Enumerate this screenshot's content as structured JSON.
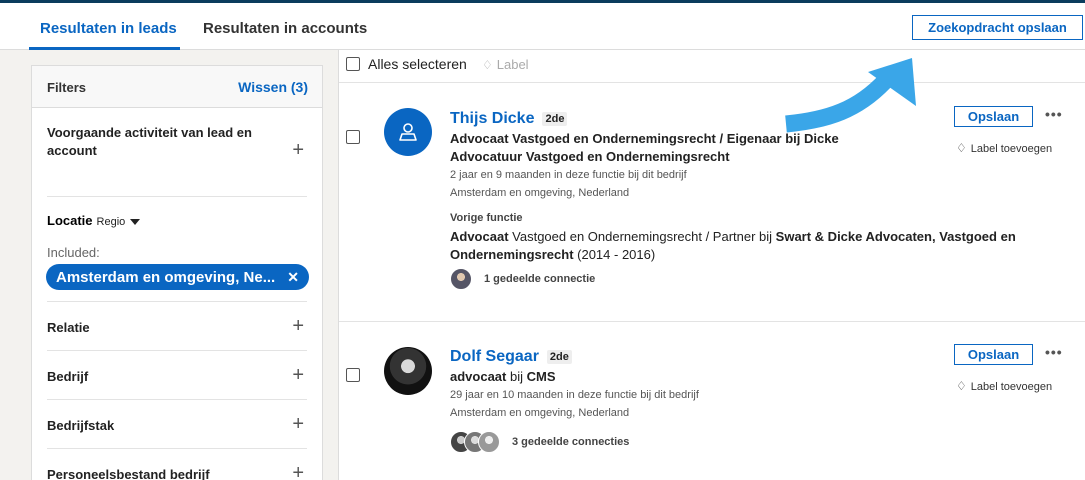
{
  "tabs": [
    {
      "label": "Resultaten in leads",
      "active": true
    },
    {
      "label": "Resultaten in accounts",
      "active": false
    }
  ],
  "save_search_label": "Zoekopdracht opslaan",
  "filters": {
    "title": "Filters",
    "clear_label": "Wissen (3)",
    "activity_label": "Voorgaande activiteit van lead en account",
    "location": {
      "label": "Locatie",
      "sub_label": "Regio",
      "included_label": "Included:",
      "pill": "Amsterdam en omgeving, Ne...",
      "pill_remove": "✕"
    },
    "items": [
      "Relatie",
      "Bedrijf",
      "Bedrijfstak",
      "Personeelsbestand bedrijf"
    ],
    "plus": "+"
  },
  "toolbar": {
    "select_all": "Alles selecteren",
    "label": "Label"
  },
  "leads": [
    {
      "name": "Thijs Dicke",
      "degree": "2de",
      "title_role": "Advocaat",
      "title_rest": " Vastgoed en Ondernemingsrecht / Eigenaar bij ",
      "company": "Dicke",
      "company_line2": "Advocatuur Vastgoed en Ondernemingsrecht",
      "tenure": "2 jaar en 9 maanden in deze functie bij dit bedrijf",
      "location": "Amsterdam en omgeving, Nederland",
      "previous_heading": "Vorige functie",
      "previous_role": "Advocaat",
      "previous_mid": " Vastgoed en Ondernemingsrecht / Partner bij ",
      "previous_company": "Swart & Dicke Advocaten, Vastgoed en Ondernemingsrecht",
      "previous_years": " (2014 - 2016)",
      "connections": "1 gedeelde connectie",
      "save_label": "Opslaan",
      "add_label": "Label toevoegen",
      "more": "•••"
    },
    {
      "name": "Dolf Segaar",
      "degree": "2de",
      "title_role": "advocaat",
      "title_mid": " bij ",
      "company": "CMS",
      "tenure": "29 jaar en 10 maanden in deze functie bij dit bedrijf",
      "location": "Amsterdam en omgeving, Nederland",
      "connections": "3 gedeelde connecties",
      "save_label": "Opslaan",
      "add_label": "Label toevoegen",
      "more": "•••"
    }
  ],
  "icons": {
    "label": "tag-icon",
    "profile_placeholder": "person-silhouette-icon",
    "arrow": "curved-arrow-icon"
  },
  "colors": {
    "accent": "#0a66c2",
    "arrow": "#3aa6e8"
  }
}
